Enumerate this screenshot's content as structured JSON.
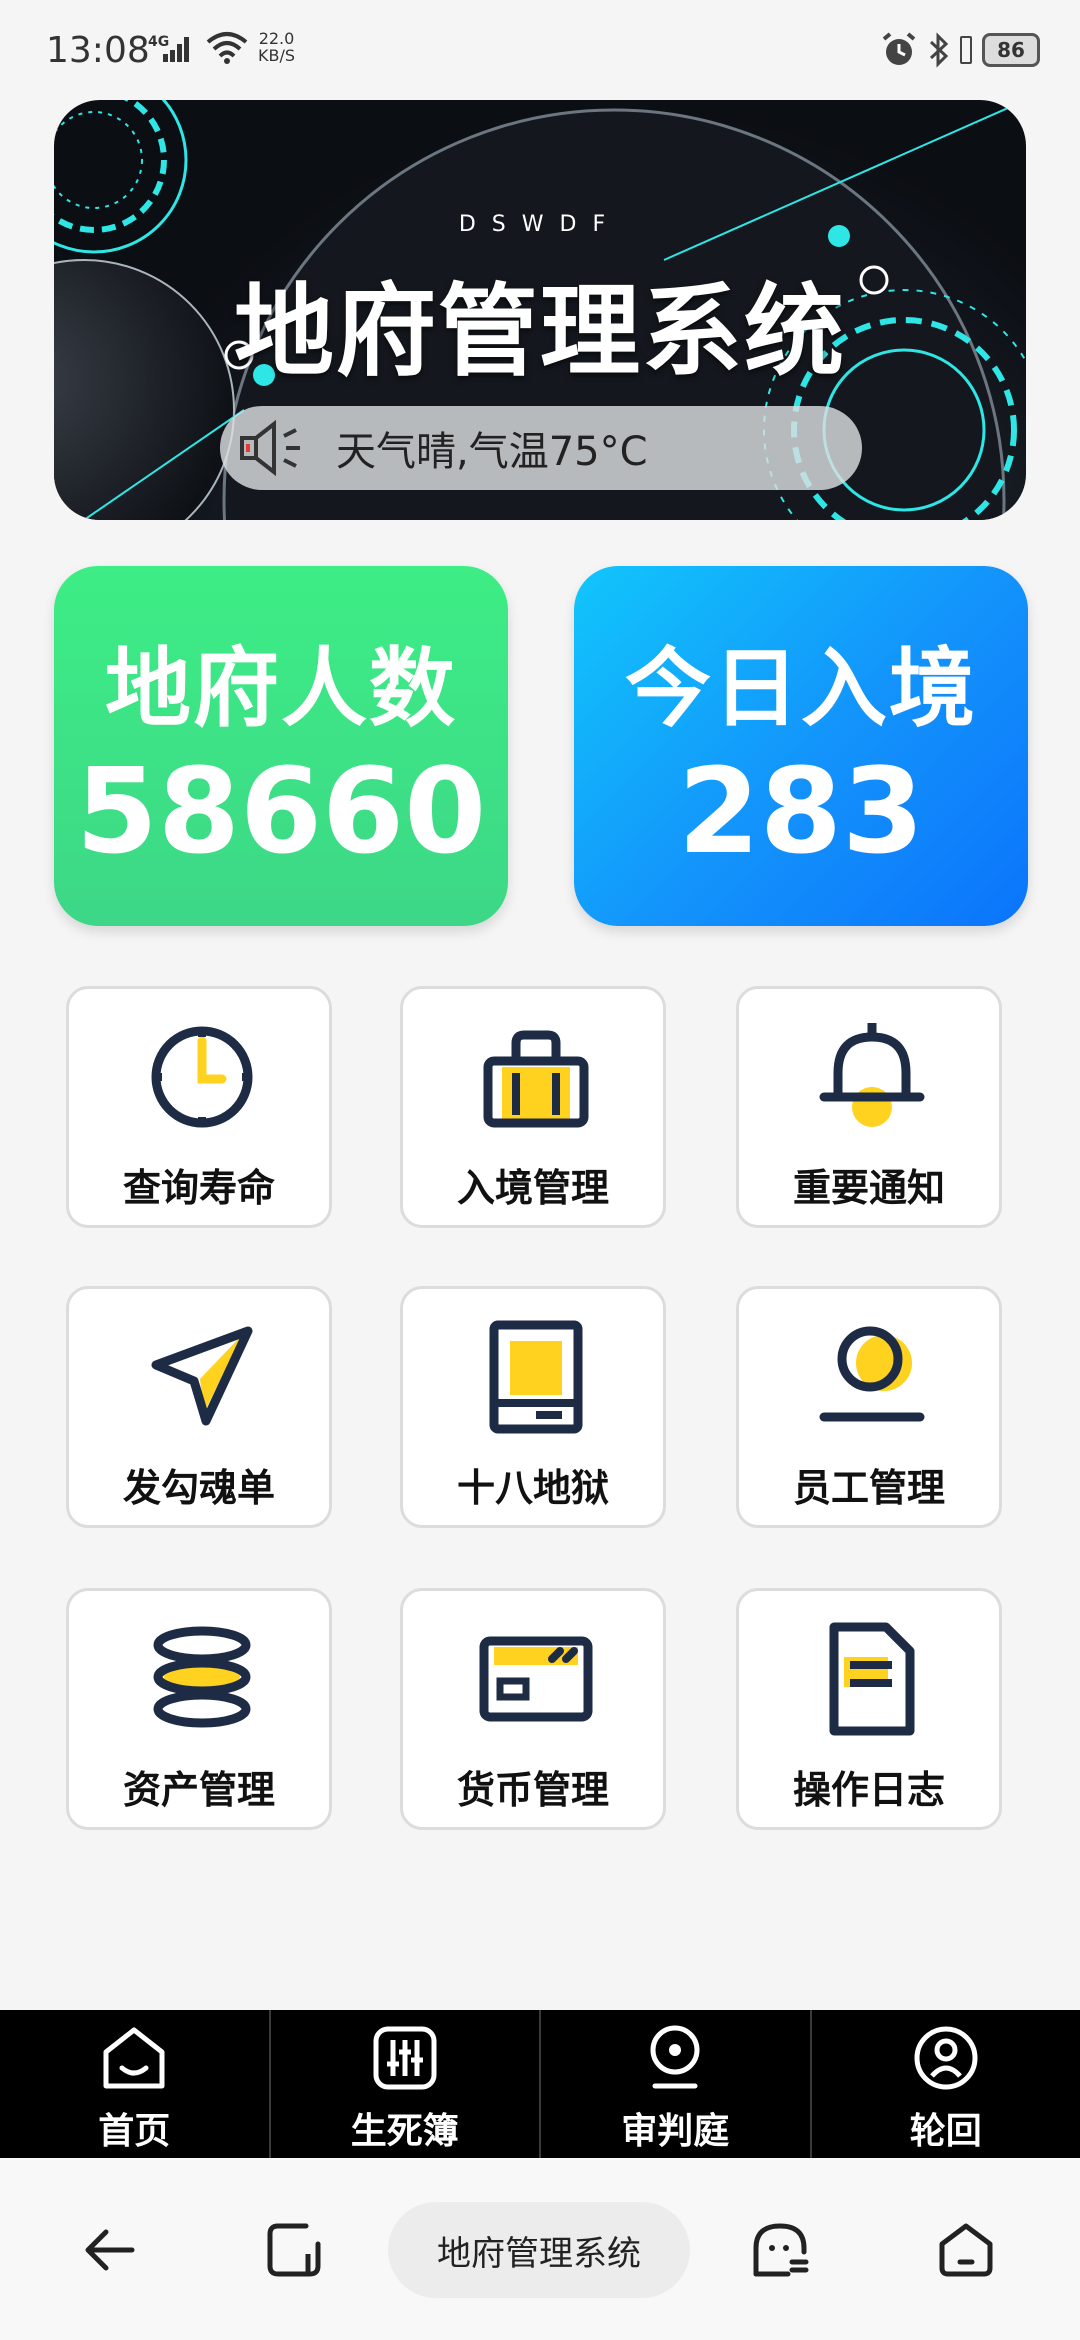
{
  "status_bar": {
    "time": "13:08",
    "network": "4G",
    "speed_value": "22.0",
    "speed_unit": "KB/S",
    "battery": "86"
  },
  "banner": {
    "subtitle": "DSWDF",
    "title": "地府管理系统",
    "notice_text": "天气晴,气温75°C",
    "icons": [
      "speaker-icon"
    ]
  },
  "stats": [
    {
      "label": "地府人数",
      "value": "58660",
      "color": "#3ddf86"
    },
    {
      "label": "今日入境",
      "value": "283",
      "color": "#0f8bfb"
    }
  ],
  "grid": {
    "items": [
      {
        "label": "查询寿命",
        "icon": "clock-icon"
      },
      {
        "label": "入境管理",
        "icon": "briefcase-icon"
      },
      {
        "label": "重要通知",
        "icon": "bell-icon"
      },
      {
        "label": "发勾魂单",
        "icon": "send-arrow-icon"
      },
      {
        "label": "十八地狱",
        "icon": "book-icon"
      },
      {
        "label": "员工管理",
        "icon": "user-icon"
      },
      {
        "label": "资产管理",
        "icon": "coin-stack-icon"
      },
      {
        "label": "货币管理",
        "icon": "card-icon"
      },
      {
        "label": "操作日志",
        "icon": "document-icon"
      }
    ],
    "accent": "#ffd21f",
    "stroke": "#1e2b45"
  },
  "tabbar": {
    "items": [
      {
        "label": "首页",
        "icon": "home-icon"
      },
      {
        "label": "生死簿",
        "icon": "sliders-icon"
      },
      {
        "label": "审判庭",
        "icon": "location-pin-icon"
      },
      {
        "label": "轮回",
        "icon": "person-circle-icon"
      }
    ]
  },
  "system_nav": {
    "center_label": "地府管理系统",
    "buttons": [
      "back-icon",
      "recents-icon",
      "assistant-icon",
      "home-icon"
    ]
  }
}
